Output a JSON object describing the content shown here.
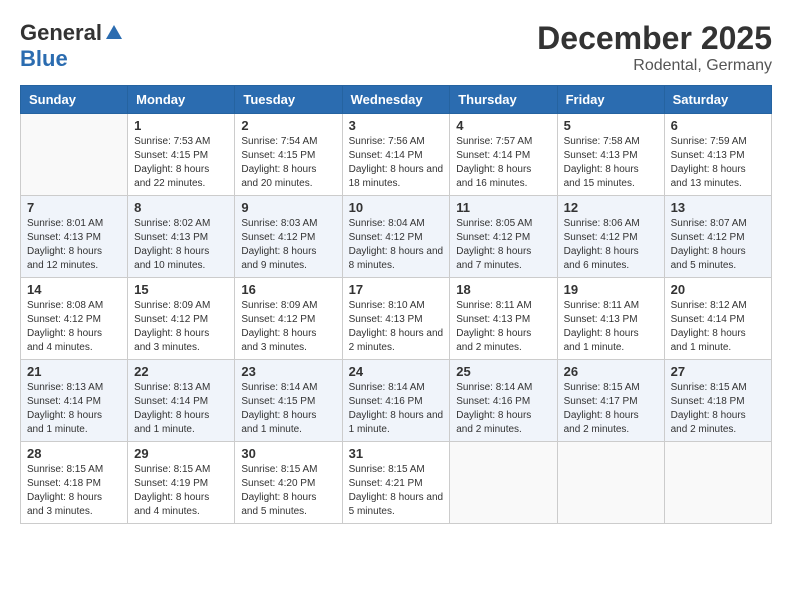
{
  "header": {
    "logo_general": "General",
    "logo_blue": "Blue",
    "month_title": "December 2025",
    "location": "Rodental, Germany"
  },
  "days_of_week": [
    "Sunday",
    "Monday",
    "Tuesday",
    "Wednesday",
    "Thursday",
    "Friday",
    "Saturday"
  ],
  "weeks": [
    [
      {
        "day": "",
        "sunrise": "",
        "sunset": "",
        "daylight": ""
      },
      {
        "day": "1",
        "sunrise": "Sunrise: 7:53 AM",
        "sunset": "Sunset: 4:15 PM",
        "daylight": "Daylight: 8 hours and 22 minutes."
      },
      {
        "day": "2",
        "sunrise": "Sunrise: 7:54 AM",
        "sunset": "Sunset: 4:15 PM",
        "daylight": "Daylight: 8 hours and 20 minutes."
      },
      {
        "day": "3",
        "sunrise": "Sunrise: 7:56 AM",
        "sunset": "Sunset: 4:14 PM",
        "daylight": "Daylight: 8 hours and 18 minutes."
      },
      {
        "day": "4",
        "sunrise": "Sunrise: 7:57 AM",
        "sunset": "Sunset: 4:14 PM",
        "daylight": "Daylight: 8 hours and 16 minutes."
      },
      {
        "day": "5",
        "sunrise": "Sunrise: 7:58 AM",
        "sunset": "Sunset: 4:13 PM",
        "daylight": "Daylight: 8 hours and 15 minutes."
      },
      {
        "day": "6",
        "sunrise": "Sunrise: 7:59 AM",
        "sunset": "Sunset: 4:13 PM",
        "daylight": "Daylight: 8 hours and 13 minutes."
      }
    ],
    [
      {
        "day": "7",
        "sunrise": "Sunrise: 8:01 AM",
        "sunset": "Sunset: 4:13 PM",
        "daylight": "Daylight: 8 hours and 12 minutes."
      },
      {
        "day": "8",
        "sunrise": "Sunrise: 8:02 AM",
        "sunset": "Sunset: 4:13 PM",
        "daylight": "Daylight: 8 hours and 10 minutes."
      },
      {
        "day": "9",
        "sunrise": "Sunrise: 8:03 AM",
        "sunset": "Sunset: 4:12 PM",
        "daylight": "Daylight: 8 hours and 9 minutes."
      },
      {
        "day": "10",
        "sunrise": "Sunrise: 8:04 AM",
        "sunset": "Sunset: 4:12 PM",
        "daylight": "Daylight: 8 hours and 8 minutes."
      },
      {
        "day": "11",
        "sunrise": "Sunrise: 8:05 AM",
        "sunset": "Sunset: 4:12 PM",
        "daylight": "Daylight: 8 hours and 7 minutes."
      },
      {
        "day": "12",
        "sunrise": "Sunrise: 8:06 AM",
        "sunset": "Sunset: 4:12 PM",
        "daylight": "Daylight: 8 hours and 6 minutes."
      },
      {
        "day": "13",
        "sunrise": "Sunrise: 8:07 AM",
        "sunset": "Sunset: 4:12 PM",
        "daylight": "Daylight: 8 hours and 5 minutes."
      }
    ],
    [
      {
        "day": "14",
        "sunrise": "Sunrise: 8:08 AM",
        "sunset": "Sunset: 4:12 PM",
        "daylight": "Daylight: 8 hours and 4 minutes."
      },
      {
        "day": "15",
        "sunrise": "Sunrise: 8:09 AM",
        "sunset": "Sunset: 4:12 PM",
        "daylight": "Daylight: 8 hours and 3 minutes."
      },
      {
        "day": "16",
        "sunrise": "Sunrise: 8:09 AM",
        "sunset": "Sunset: 4:12 PM",
        "daylight": "Daylight: 8 hours and 3 minutes."
      },
      {
        "day": "17",
        "sunrise": "Sunrise: 8:10 AM",
        "sunset": "Sunset: 4:13 PM",
        "daylight": "Daylight: 8 hours and 2 minutes."
      },
      {
        "day": "18",
        "sunrise": "Sunrise: 8:11 AM",
        "sunset": "Sunset: 4:13 PM",
        "daylight": "Daylight: 8 hours and 2 minutes."
      },
      {
        "day": "19",
        "sunrise": "Sunrise: 8:11 AM",
        "sunset": "Sunset: 4:13 PM",
        "daylight": "Daylight: 8 hours and 1 minute."
      },
      {
        "day": "20",
        "sunrise": "Sunrise: 8:12 AM",
        "sunset": "Sunset: 4:14 PM",
        "daylight": "Daylight: 8 hours and 1 minute."
      }
    ],
    [
      {
        "day": "21",
        "sunrise": "Sunrise: 8:13 AM",
        "sunset": "Sunset: 4:14 PM",
        "daylight": "Daylight: 8 hours and 1 minute."
      },
      {
        "day": "22",
        "sunrise": "Sunrise: 8:13 AM",
        "sunset": "Sunset: 4:14 PM",
        "daylight": "Daylight: 8 hours and 1 minute."
      },
      {
        "day": "23",
        "sunrise": "Sunrise: 8:14 AM",
        "sunset": "Sunset: 4:15 PM",
        "daylight": "Daylight: 8 hours and 1 minute."
      },
      {
        "day": "24",
        "sunrise": "Sunrise: 8:14 AM",
        "sunset": "Sunset: 4:16 PM",
        "daylight": "Daylight: 8 hours and 1 minute."
      },
      {
        "day": "25",
        "sunrise": "Sunrise: 8:14 AM",
        "sunset": "Sunset: 4:16 PM",
        "daylight": "Daylight: 8 hours and 2 minutes."
      },
      {
        "day": "26",
        "sunrise": "Sunrise: 8:15 AM",
        "sunset": "Sunset: 4:17 PM",
        "daylight": "Daylight: 8 hours and 2 minutes."
      },
      {
        "day": "27",
        "sunrise": "Sunrise: 8:15 AM",
        "sunset": "Sunset: 4:18 PM",
        "daylight": "Daylight: 8 hours and 2 minutes."
      }
    ],
    [
      {
        "day": "28",
        "sunrise": "Sunrise: 8:15 AM",
        "sunset": "Sunset: 4:18 PM",
        "daylight": "Daylight: 8 hours and 3 minutes."
      },
      {
        "day": "29",
        "sunrise": "Sunrise: 8:15 AM",
        "sunset": "Sunset: 4:19 PM",
        "daylight": "Daylight: 8 hours and 4 minutes."
      },
      {
        "day": "30",
        "sunrise": "Sunrise: 8:15 AM",
        "sunset": "Sunset: 4:20 PM",
        "daylight": "Daylight: 8 hours and 5 minutes."
      },
      {
        "day": "31",
        "sunrise": "Sunrise: 8:15 AM",
        "sunset": "Sunset: 4:21 PM",
        "daylight": "Daylight: 8 hours and 5 minutes."
      },
      {
        "day": "",
        "sunrise": "",
        "sunset": "",
        "daylight": ""
      },
      {
        "day": "",
        "sunrise": "",
        "sunset": "",
        "daylight": ""
      },
      {
        "day": "",
        "sunrise": "",
        "sunset": "",
        "daylight": ""
      }
    ]
  ]
}
